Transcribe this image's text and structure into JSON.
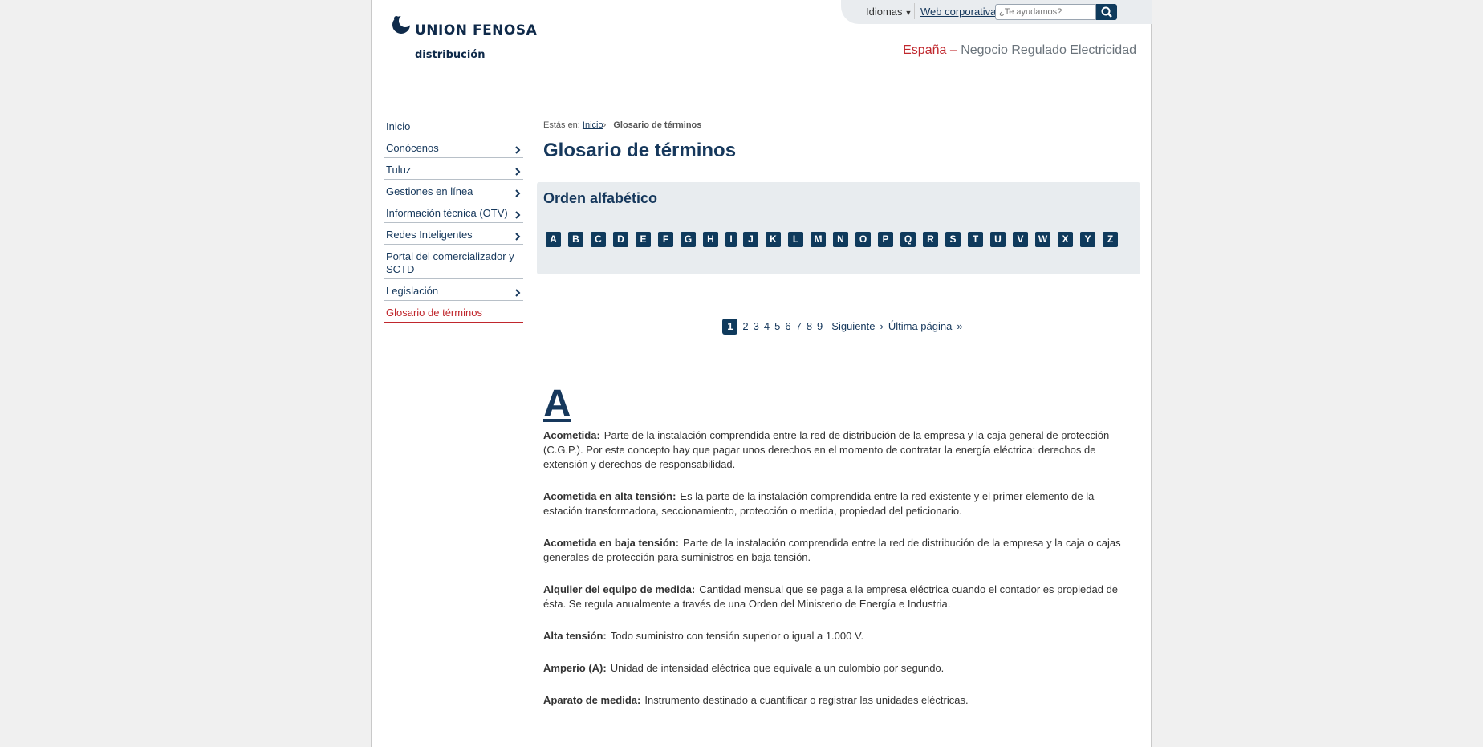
{
  "brand": {
    "name": "UNION FENOSA",
    "sub": "distribución"
  },
  "topbar": {
    "idiomas": "Idiomas",
    "web_corporativa": "Web corporativa",
    "search_placeholder": "¿Te ayudamos?"
  },
  "region": {
    "country": "España",
    "dash": "–",
    "segment": "Negocio Regulado Electricidad"
  },
  "sidebar": {
    "items": [
      {
        "label": "Inicio",
        "has_arrow": false
      },
      {
        "label": "Conócenos",
        "has_arrow": true
      },
      {
        "label": "Tuluz",
        "has_arrow": true
      },
      {
        "label": "Gestiones en línea",
        "has_arrow": true
      },
      {
        "label": "Información técnica (OTV)",
        "has_arrow": true
      },
      {
        "label": "Redes Inteligentes",
        "has_arrow": true
      },
      {
        "label": "Portal del comercializador y SCTD",
        "has_arrow": false
      },
      {
        "label": "Legislación",
        "has_arrow": true
      },
      {
        "label": "Glosario de términos",
        "has_arrow": false,
        "active": true
      }
    ]
  },
  "breadcrumb": {
    "prefix": "Estás en:",
    "home": "Inicio",
    "current": "Glosario de términos"
  },
  "page_title": "Glosario de términos",
  "alphabet": {
    "title": "Orden alfabético",
    "letters": [
      "A",
      "B",
      "C",
      "D",
      "E",
      "F",
      "G",
      "H",
      "I",
      "J",
      "K",
      "L",
      "M",
      "N",
      "O",
      "P",
      "Q",
      "R",
      "S",
      "T",
      "U",
      "V",
      "W",
      "X",
      "Y",
      "Z"
    ]
  },
  "pager": {
    "current": "1",
    "pages": [
      "2",
      "3",
      "4",
      "5",
      "6",
      "7",
      "8",
      "9"
    ],
    "next": "Siguiente",
    "last": "Última página"
  },
  "section_letter": "A",
  "definitions": [
    {
      "term": "Acometida:",
      "text": "Parte de la instalación comprendida entre la red de distribución de la empresa y la caja general de protección (C.G.P.). Por este concepto hay que pagar unos derechos en el momento de contratar la energía eléctrica: derechos de extensión y derechos de responsabilidad."
    },
    {
      "term": "Acometida en alta tensión:",
      "text": "Es la parte de la instalación comprendida entre la red existente y el primer elemento de la estación transformadora, seccionamiento, protección o medida, propiedad del peticionario."
    },
    {
      "term": "Acometida en baja tensión:",
      "text": "Parte de la instalación comprendida entre la red de distribución de la empresa y la caja o cajas generales de protección para suministros en baja tensión."
    },
    {
      "term": "Alquiler del equipo de medida:",
      "text": "Cantidad mensual que se paga a la empresa eléctrica cuando el contador es propiedad de ésta. Se regula anualmente a través de una Orden del Ministerio de Energía e Industria."
    },
    {
      "term": "Alta tensión:",
      "text": "Todo suministro con tensión superior o igual a 1.000 V."
    },
    {
      "term": "Amperio (A):",
      "text": "Unidad de intensidad eléctrica que equivale a un culombio por segundo."
    },
    {
      "term": "Aparato de medida:",
      "text": "Instrumento destinado a cuantificar o registrar las unidades eléctricas."
    }
  ]
}
